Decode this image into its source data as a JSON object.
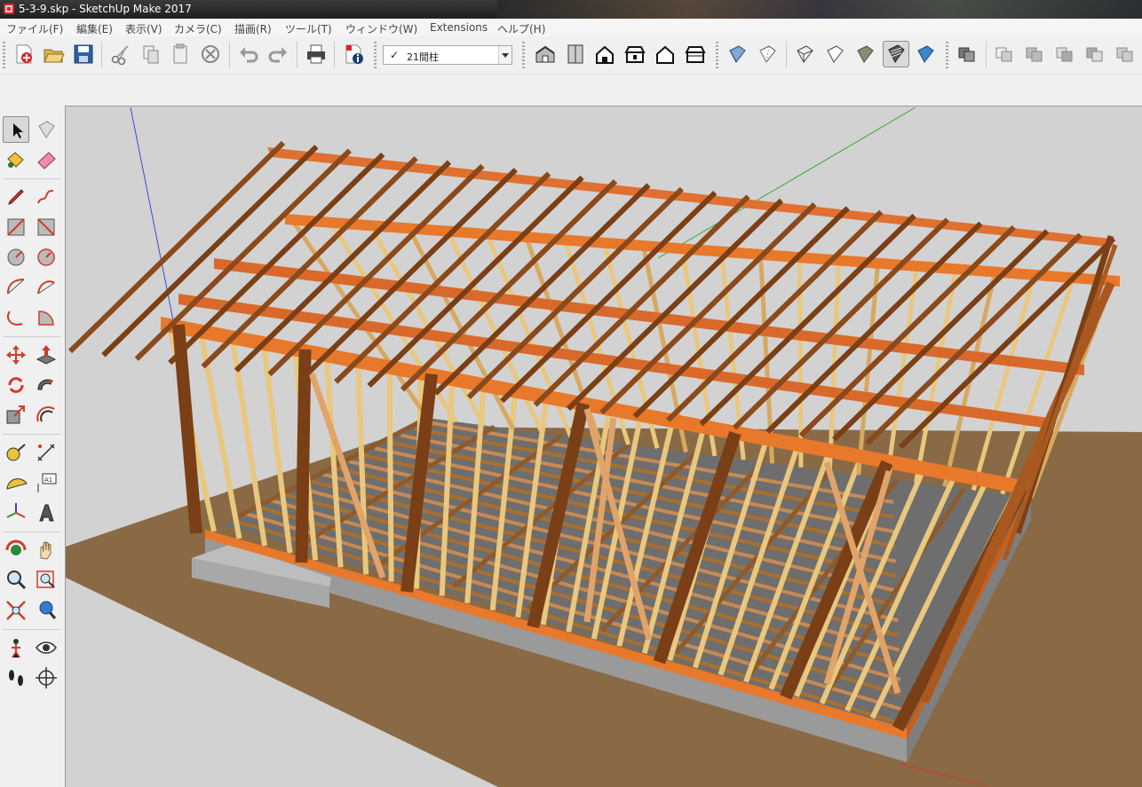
{
  "window": {
    "title": "5-3-9.skp - SketchUp Make 2017",
    "app_icon": "sketchup-logo-icon"
  },
  "menu": [
    {
      "id": "file",
      "label": "ファイル(F)"
    },
    {
      "id": "edit",
      "label": "編集(E)"
    },
    {
      "id": "view",
      "label": "表示(V)"
    },
    {
      "id": "camera",
      "label": "カメラ(C)"
    },
    {
      "id": "draw",
      "label": "描画(R)"
    },
    {
      "id": "tools",
      "label": "ツール(T)"
    },
    {
      "id": "window",
      "label": "ウィンドウ(W)"
    },
    {
      "id": "extensions",
      "label": "Extensions"
    },
    {
      "id": "help",
      "label": "ヘルプ(H)"
    }
  ],
  "toolbar": {
    "layer_select": {
      "checked": "✓",
      "value": "21間柱"
    },
    "active_style": "shaded-with-textures-icon"
  },
  "palette": {
    "active_tool": "select-tool"
  },
  "colors": {
    "ground": "#8a6a45",
    "foundation": "#9c9c9c",
    "sill": "#e8782a",
    "timber_dark": "#7a3f16",
    "timber_mid": "#a9591f",
    "stud_light": "#e9c77e",
    "sky": "#d2d2d2"
  }
}
